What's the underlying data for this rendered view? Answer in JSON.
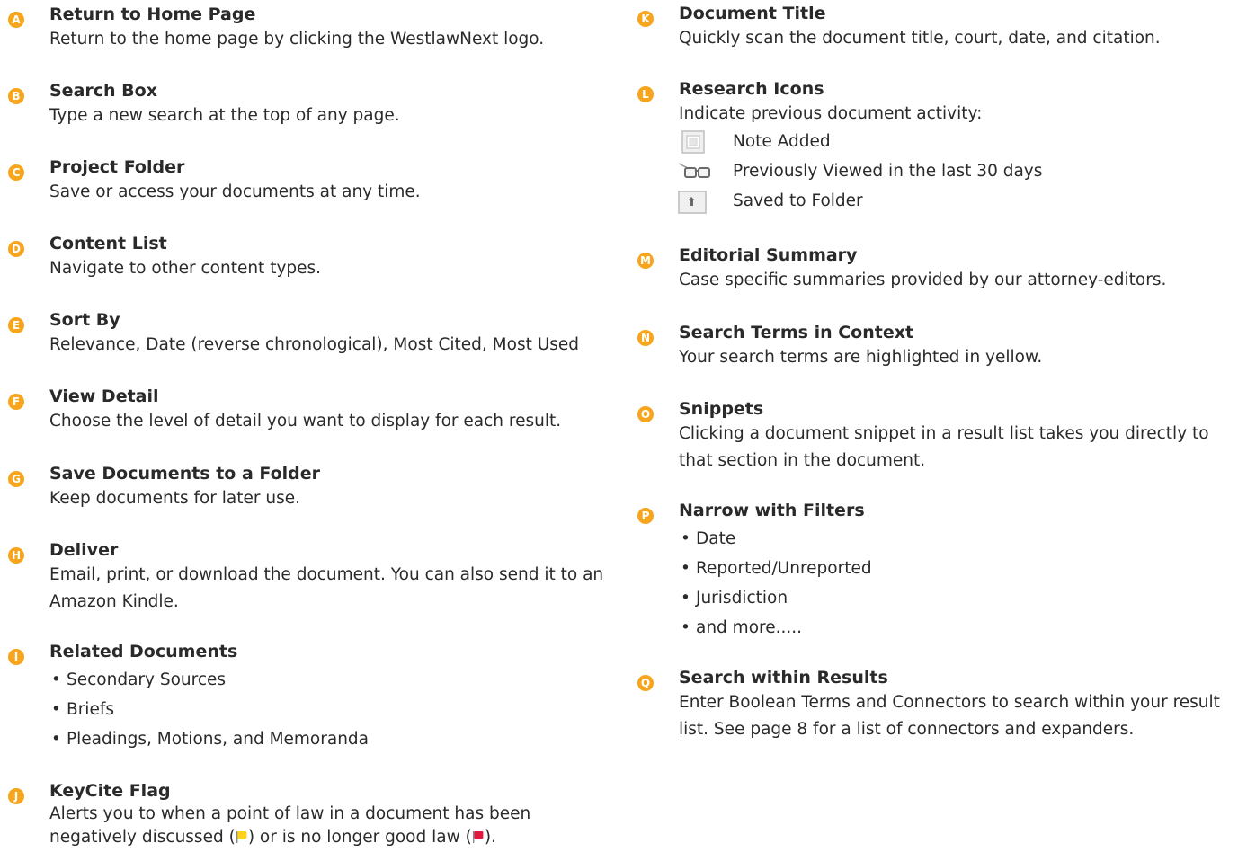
{
  "left": [
    {
      "letter": "A",
      "title": "Return to Home Page",
      "desc": "Return to the home page by clicking the WestlawNext logo."
    },
    {
      "letter": "B",
      "title": "Search Box",
      "desc": "Type a new search at the top of any page."
    },
    {
      "letter": "C",
      "title": "Project Folder",
      "desc": "Save or access your documents at any time."
    },
    {
      "letter": "D",
      "title": "Content List",
      "desc": "Navigate to other content types."
    },
    {
      "letter": "E",
      "title": "Sort By",
      "desc": "Relevance, Date (reverse chronological), Most Cited, Most Used"
    },
    {
      "letter": "F",
      "title": "View Detail",
      "desc": "Choose the level of detail you want to display for each result."
    },
    {
      "letter": "G",
      "title": "Save Documents to a Folder",
      "desc": "Keep documents for later use."
    },
    {
      "letter": "H",
      "title": "Deliver",
      "desc": "Email, print, or download the document. You can also send it to an Amazon Kindle."
    },
    {
      "letter": "I",
      "title": "Related Documents",
      "bullets": [
        "Secondary Sources",
        "Briefs",
        "Pleadings, Motions, and Memoranda"
      ]
    },
    {
      "letter": "J",
      "title": "KeyCite Flag",
      "desc_start": "Alerts you to when a point of law in a document has been negatively discussed (",
      "desc_mid": ") or is no longer good law (",
      "desc_end": ")."
    }
  ],
  "right": [
    {
      "letter": "K",
      "title": "Document Title",
      "desc": "Quickly scan the document title, court, date, and citation."
    },
    {
      "letter": "L",
      "title": "Research Icons",
      "desc": "Indicate previous document activity:",
      "icons": [
        {
          "icon": "note-added-icon",
          "label": "Note Added"
        },
        {
          "icon": "previously-viewed-icon",
          "label": "Previously Viewed in the last 30 days"
        },
        {
          "icon": "saved-to-folder-icon",
          "label": "Saved to Folder"
        }
      ]
    },
    {
      "letter": "M",
      "title": "Editorial Summary",
      "desc": "Case specific summaries provided by our attorney-editors."
    },
    {
      "letter": "N",
      "title": "Search Terms in Context",
      "desc": "Your search terms are highlighted in yellow."
    },
    {
      "letter": "O",
      "title": "Snippets",
      "desc": "Clicking a document snippet in a result list takes you directly to that section in the document."
    },
    {
      "letter": "P",
      "title": "Narrow with Filters",
      "bullets": [
        "Date",
        "Reported/Unreported",
        "Jurisdiction",
        "and more....."
      ]
    },
    {
      "letter": "Q",
      "title": "Search within Results",
      "desc": "Enter Boolean Terms and Connectors to search within your result list. See page 8 for a list of connectors and expanders."
    }
  ],
  "colors": {
    "badge": "#F7A51C",
    "yellow_flag": "#FFD21A",
    "red_flag": "#E3173E"
  }
}
